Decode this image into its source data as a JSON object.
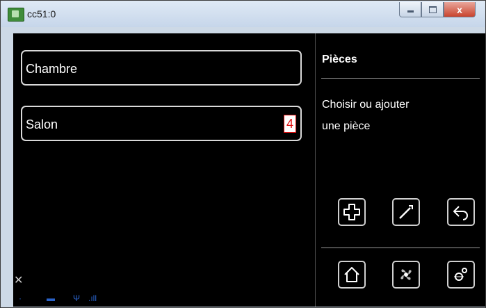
{
  "window": {
    "title": "cc51:0",
    "icons": {
      "app": "app-icon",
      "minimize": "minimize-icon",
      "maximize": "maximize-icon",
      "close": "close-icon"
    },
    "close_glyph": "x"
  },
  "rooms": [
    {
      "label": "Chambre"
    },
    {
      "label": "Salon",
      "badge": "4"
    }
  ],
  "side_panel": {
    "title": "Pièces",
    "description_line1": "Choisir ou ajouter",
    "description_line2": "une pièce"
  },
  "toolbar": {
    "row1": [
      "add-icon",
      "wrench-icon",
      "undo-icon"
    ],
    "row2": [
      "home-icon",
      "fan-icon",
      "settings-icon"
    ]
  },
  "status": {
    "left_symbol": "✕",
    "indicators": [
      "·",
      "▬",
      "Ψ",
      ".ıll"
    ]
  },
  "colors": {
    "background": "#000000",
    "text": "#ffffff",
    "border": "#d9d9d9",
    "badge_text": "#e01010",
    "status_icons": "#2a63c9"
  }
}
